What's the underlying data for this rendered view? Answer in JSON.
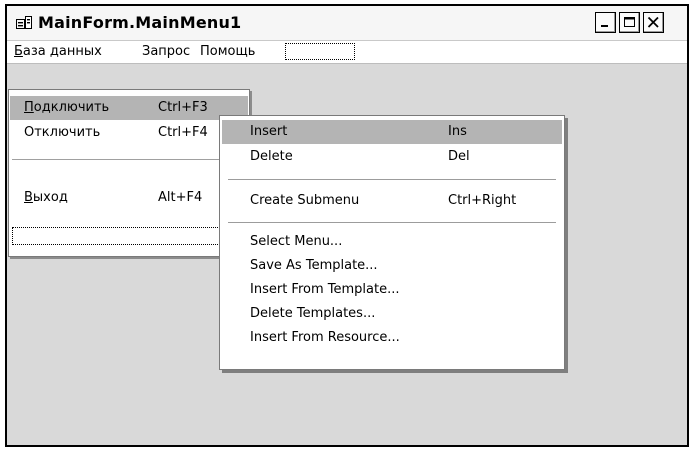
{
  "window": {
    "title": "MainForm.MainMenu1",
    "icon": "menu-designer-icon",
    "buttons": [
      "minimize",
      "maximize",
      "close"
    ]
  },
  "menubar": {
    "items": [
      {
        "label": "База данных"
      },
      {
        "label": "Запрос"
      },
      {
        "label": "Помощь"
      }
    ]
  },
  "dropdown": {
    "items": [
      {
        "label": "Подключить",
        "shortcut": "Ctrl+F3",
        "selected": true
      },
      {
        "label": "Отключить",
        "shortcut": "Ctrl+F4"
      },
      {
        "label": "Выход",
        "shortcut": "Alt+F4"
      }
    ]
  },
  "context_menu": {
    "items": [
      {
        "label": "Insert",
        "shortcut": "Ins",
        "selected": true
      },
      {
        "label": "Delete",
        "shortcut": "Del"
      },
      {
        "label": "Create Submenu",
        "shortcut": "Ctrl+Right"
      },
      {
        "label": "Select Menu..."
      },
      {
        "label": "Save As Template..."
      },
      {
        "label": "Insert From Template..."
      },
      {
        "label": "Delete Templates..."
      },
      {
        "label": "Insert From Resource..."
      }
    ]
  },
  "colors": {
    "client_bg": "#d9d9d9",
    "highlight": "#b4b4b4",
    "border": "#000000"
  }
}
